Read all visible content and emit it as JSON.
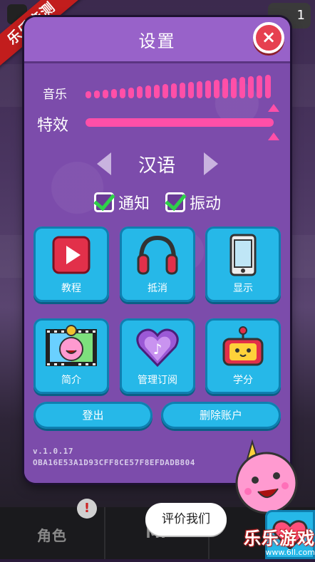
{
  "corner_ribbon": "乐乐亲测",
  "background": {
    "top_right_count": "1",
    "bottom_tabs": [
      "角色",
      "MI"
    ],
    "alert_icon": "!"
  },
  "settings": {
    "title": "设置",
    "close_icon": "×",
    "music_label": "音乐",
    "effects_label": "特效",
    "music_level": 1.0,
    "effects_level": 1.0,
    "language": "汉语",
    "notify_label": "通知",
    "notify_checked": true,
    "vibrate_label": "振动",
    "vibrate_checked": true,
    "tiles": [
      {
        "label": "教程",
        "icon": "play-icon"
      },
      {
        "label": "抵消",
        "icon": "headphones-icon"
      },
      {
        "label": "显示",
        "icon": "phone-icon"
      },
      {
        "label": "简介",
        "icon": "film-bird-icon"
      },
      {
        "label": "管理订阅",
        "icon": "heart-gem-icon"
      },
      {
        "label": "学分",
        "icon": "robot-icon"
      }
    ],
    "logout_label": "登出",
    "delete_account_label": "删除账户",
    "version": "v.1.0.17",
    "device_id": "OBA16E53A1D93CFF8CE57F8EFDADB804"
  },
  "rate_us": "评价我们",
  "watermark": {
    "brand": "乐乐游戏",
    "site": "www.6ll.com"
  },
  "colors": {
    "accent_pink": "#ff4fa8",
    "tile_blue": "#26b8e8",
    "panel_purple": "#7c4cab",
    "close_red": "#e64050",
    "check_green": "#2fd04a"
  }
}
